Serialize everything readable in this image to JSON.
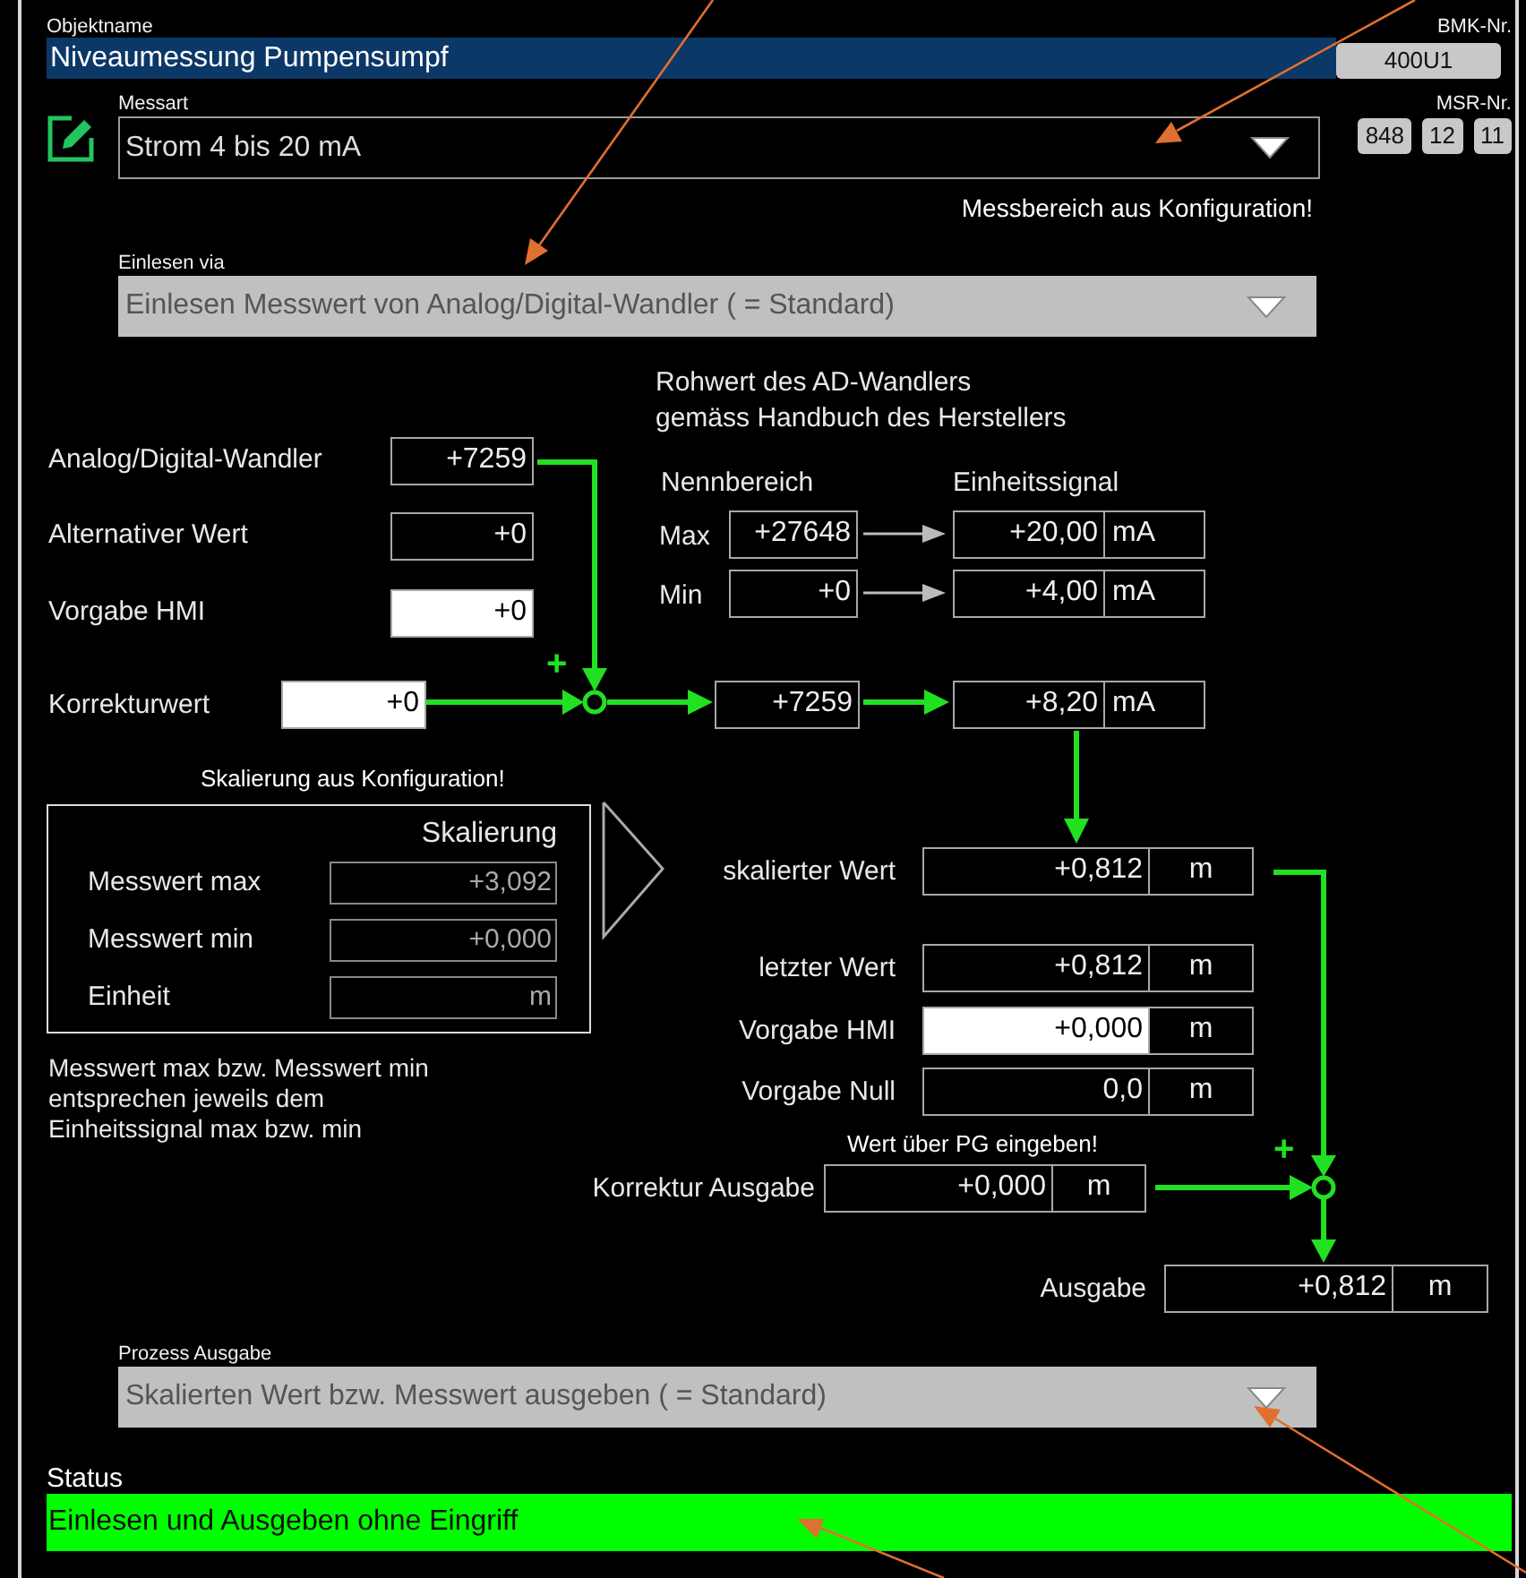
{
  "header": {
    "object_label": "Objektname",
    "object_name": "Niveaumessung Pumpensumpf",
    "bmk_label": "BMK-Nr.",
    "bmk_number": "400U1"
  },
  "measurement_type": {
    "label": "Messart",
    "value": "Strom 4 bis 20 mA",
    "disabled": false
  },
  "msr": {
    "label": "MSR-Nr.",
    "numbers": [
      "848",
      "12",
      "11"
    ]
  },
  "range_note": "Messbereich aus Konfiguration!",
  "input_source": {
    "label": "Einlesen via",
    "value": "Einlesen Messwert von Analog/Digital-Wandler ( = Standard)",
    "disabled": true
  },
  "raw_value": {
    "title": "Rohwert des AD-Wandlers\ngemäss Handbuch des Herstellers",
    "nominal_header": "Nennbereich",
    "signal_header": "Einheitssignal",
    "rows": [
      {
        "label": "Max",
        "raw": "+27648",
        "signal": "+20,00",
        "unit": "mA"
      },
      {
        "label": "Min",
        "raw": "+0",
        "signal": "+4,00",
        "unit": "mA"
      }
    ]
  },
  "inputs": [
    {
      "label": "Analog/Digital-Wandler",
      "value": "+7259",
      "editable": false
    },
    {
      "label": "Alternativer Wert",
      "value": "+0",
      "editable": false
    },
    {
      "label": "Vorgabe HMI",
      "value": "+0",
      "editable": true
    }
  ],
  "correction": {
    "label": "Korrekturwert",
    "value": "+0",
    "editable": true,
    "sign": "+"
  },
  "sum": {
    "raw": "+7259",
    "signal": "+8,20",
    "unit": "mA"
  },
  "scaling": {
    "note": "Skalierung aus Konfiguration!",
    "title": "Skalierung",
    "rows": [
      {
        "label": "Messwert max",
        "value": "+3,092"
      },
      {
        "label": "Messwert min",
        "value": "+0,000"
      },
      {
        "label": "Einheit",
        "value": "m"
      }
    ],
    "explanation": "Messwert max bzw. Messwert min\nentsprechen jeweils dem\nEinheitssignal max bzw. min"
  },
  "outputs": [
    {
      "label": "skalierter Wert",
      "value": "+0,812",
      "unit": "m",
      "editable": false
    },
    {
      "label": "letzter Wert",
      "value": "+0,812",
      "unit": "m",
      "editable": false
    },
    {
      "label": "Vorgabe HMI",
      "value": "+0,000",
      "unit": "m",
      "editable": true
    },
    {
      "label": "Vorgabe Null",
      "value": "0,0",
      "unit": "m",
      "editable": false
    }
  ],
  "output_correction": {
    "note": "Wert über PG eingeben!",
    "label": "Korrektur Ausgabe",
    "value": "+0,000",
    "unit": "m",
    "sign": "+"
  },
  "output": {
    "label": "Ausgabe",
    "value": "+0,812",
    "unit": "m"
  },
  "process_output": {
    "label": "Prozess Ausgabe",
    "value": "Skalierten Wert bzw. Messwert ausgeben ( = Standard)",
    "disabled": true
  },
  "status": {
    "label": "Status",
    "text": "Einlesen und Ausgeben ohne Eingriff",
    "ok": true
  }
}
